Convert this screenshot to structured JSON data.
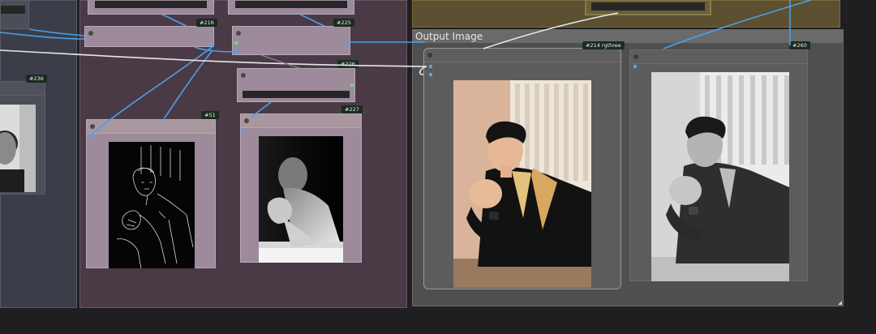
{
  "colors": {
    "canvas": "#1f1f21",
    "group_purple": "#4a3a46",
    "group_gray": "#3b3e48",
    "group_output": "#4f4f4f",
    "group_olive": "#5b5030",
    "node_purple": "#9d8a9b",
    "node_dark": "#5c5c5c",
    "wire_blue": "#4a9fe6",
    "wire_white": "#e6e6e6",
    "port_green": "#67e06a"
  },
  "output_group": {
    "title": "Output Image"
  },
  "nodes": {
    "n236": {
      "badge": "#236"
    },
    "n216": {
      "badge": "#216"
    },
    "n225": {
      "badge": "#225"
    },
    "n226": {
      "badge": "#226"
    },
    "n51": {
      "badge": "#51"
    },
    "n227": {
      "badge": "#227"
    },
    "n214": {
      "badge": "#214 rgthree"
    },
    "n260": {
      "badge": "#260"
    }
  },
  "icons": {
    "node_collapse": "circle-dot-icon",
    "port_input": "square-port-icon",
    "resize": "corner-resize-icon"
  }
}
